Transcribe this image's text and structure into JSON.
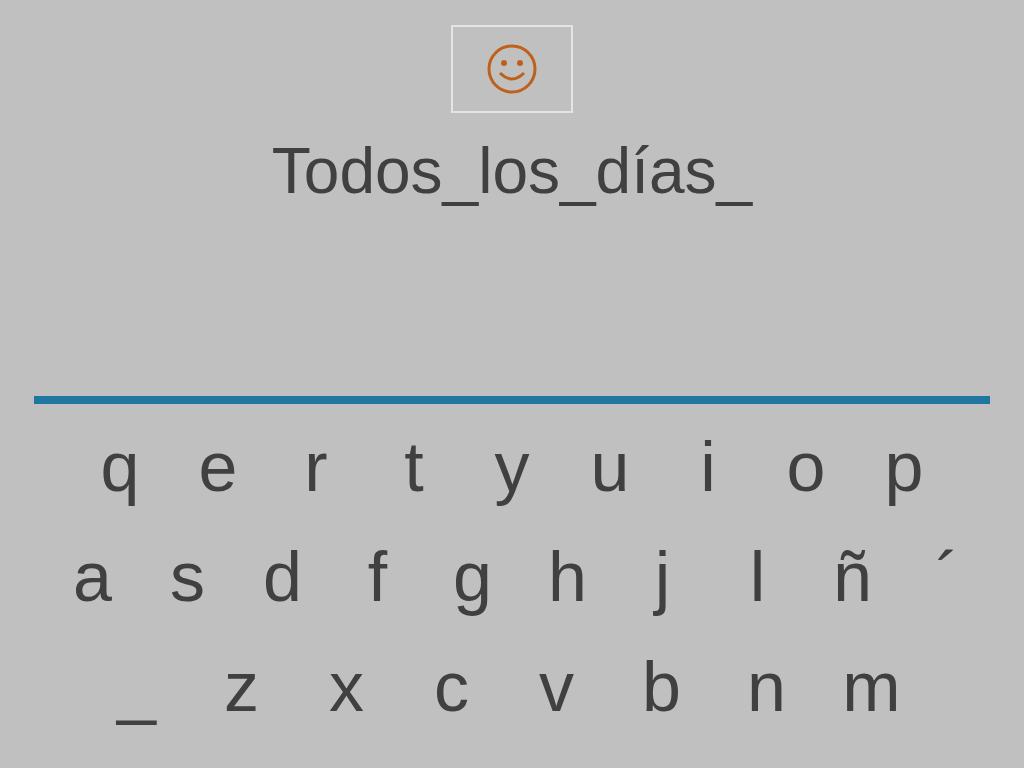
{
  "answer": "Todos_los_días_",
  "keyboard": {
    "rows": [
      [
        "q",
        "e",
        "r",
        "t",
        "y",
        "u",
        "i",
        "o",
        "p"
      ],
      [
        "a",
        "s",
        "d",
        "f",
        "g",
        "h",
        "j",
        "l",
        "ñ",
        "´"
      ],
      [
        "_",
        "z",
        "x",
        "c",
        "v",
        "b",
        "n",
        "m"
      ]
    ]
  }
}
